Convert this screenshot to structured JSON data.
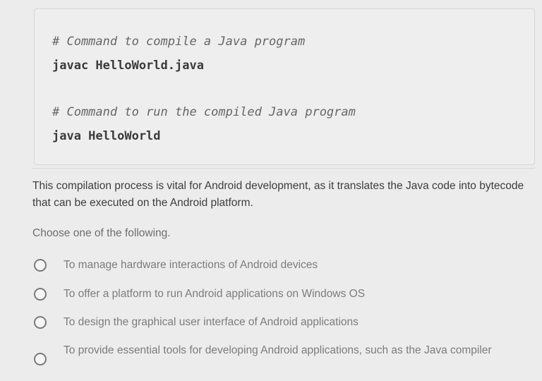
{
  "code_block": {
    "lines": [
      {
        "text": "# Command to compile a Java program",
        "kind": "comment"
      },
      {
        "text": "javac HelloWorld.java",
        "kind": "command"
      },
      {
        "text": "# Command to run the compiled Java program",
        "kind": "comment"
      },
      {
        "text": "java HelloWorld",
        "kind": "command"
      }
    ]
  },
  "question": {
    "description": "This compilation process is vital for Android development, as it translates the Java code into bytecode that can be executed on the Android platform.",
    "prompt": "Choose one of the following.",
    "options": [
      {
        "label": "To manage hardware interactions of Android devices",
        "selected": false
      },
      {
        "label": "To offer a platform to run Android applications on Windows OS",
        "selected": false
      },
      {
        "label": "To design the graphical user interface of Android applications",
        "selected": false
      },
      {
        "label": "To provide essential tools for developing Android applications, such as the Java compiler",
        "selected": false
      }
    ]
  },
  "colors": {
    "background": "#ececec",
    "code_background": "#eeeeee",
    "text_primary": "#3d3d3d",
    "text_muted": "#7c7c7c"
  }
}
